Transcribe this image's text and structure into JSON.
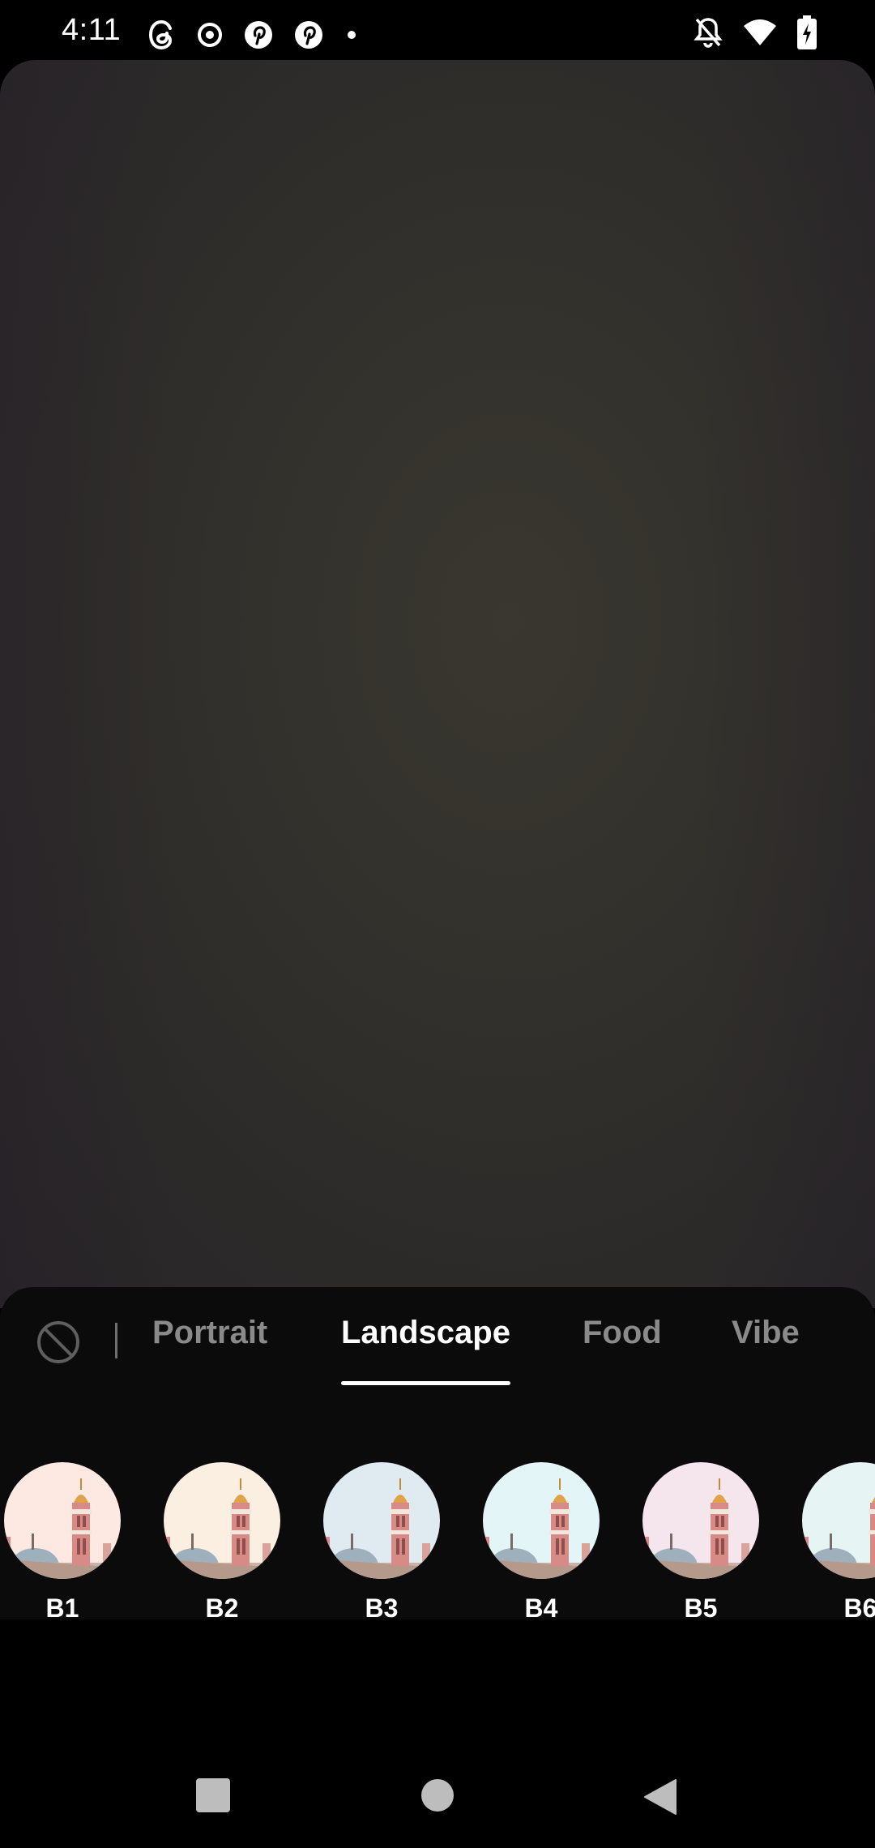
{
  "status_bar": {
    "time": "4:11",
    "left_icons": [
      "threads-icon",
      "circle-dot-icon",
      "pinterest-icon",
      "pinterest-icon",
      "dot-icon"
    ],
    "right_icons": [
      "bell-off-icon",
      "wifi-icon",
      "battery-charging-icon"
    ]
  },
  "filter_panel": {
    "no_filter_icon": "no-filter-icon",
    "tabs": [
      {
        "label": "Portrait",
        "active": false
      },
      {
        "label": "Landscape",
        "active": true
      },
      {
        "label": "Food",
        "active": false
      },
      {
        "label": "Vibe",
        "active": false
      }
    ],
    "presets": [
      {
        "label": "B1",
        "tint": "#fde9e2"
      },
      {
        "label": "B2",
        "tint": "#fbefe1"
      },
      {
        "label": "B3",
        "tint": "#dfeaf1"
      },
      {
        "label": "B4",
        "tint": "#e3f5f6"
      },
      {
        "label": "B5",
        "tint": "#f4e6ec"
      },
      {
        "label": "B6",
        "tint": "#e6f5f4"
      }
    ]
  },
  "nav": {
    "buttons": [
      "recents-square-icon",
      "home-circle-icon",
      "back-triangle-icon"
    ]
  },
  "colors": {
    "background": "#000000",
    "panel": "#0b0b0c",
    "tab_inactive": "#8a8a8a",
    "tab_active": "#ffffff"
  }
}
